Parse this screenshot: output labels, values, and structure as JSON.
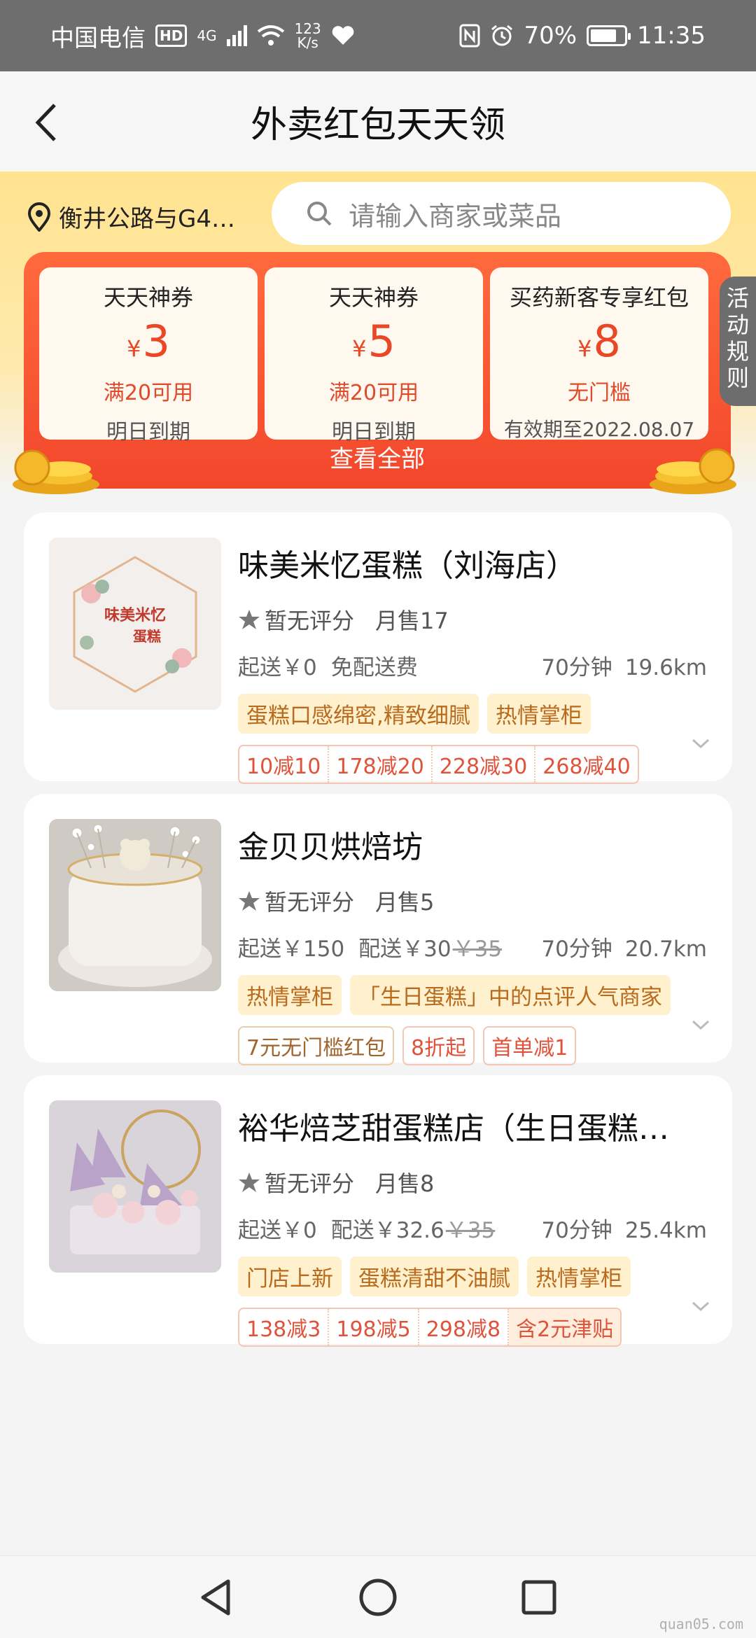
{
  "status_bar": {
    "carrier": "中国电信",
    "hd": "HD",
    "network": "4G",
    "speed_value": "123",
    "speed_unit": "K/s",
    "battery": "70%",
    "time": "11:35"
  },
  "header": {
    "title": "外卖红包天天领"
  },
  "location": {
    "text": "衡井公路与G4…"
  },
  "search": {
    "placeholder": "请输入商家或菜品"
  },
  "coupons": [
    {
      "title": "天天神券",
      "currency": "¥",
      "amount": "3",
      "condition": "满20可用",
      "expiry": "明日到期"
    },
    {
      "title": "天天神券",
      "currency": "¥",
      "amount": "5",
      "condition": "满20可用",
      "expiry": "明日到期"
    },
    {
      "title": "买药新客专享红包",
      "currency": "¥",
      "amount": "8",
      "condition": "无门槛",
      "expiry": "有效期至2022.08.07"
    }
  ],
  "view_all": "查看全部",
  "side_tab": "活动规则",
  "stores": [
    {
      "name": "味美米忆蛋糕（刘海店）",
      "rating": "暂无评分",
      "sales": "月售17",
      "min_order": "起送￥0",
      "delivery_fee": "免配送费",
      "delivery_fee_original": "",
      "time": "70分钟",
      "distance": "19.6km",
      "tags": [
        "蛋糕口感绵密,精致细腻",
        "热情掌柜"
      ],
      "promos": [
        "10减10",
        "178减20",
        "228减30",
        "268减40"
      ]
    },
    {
      "name": "金贝贝烘焙坊",
      "rating": "暂无评分",
      "sales": "月售5",
      "min_order": "起送￥150",
      "delivery_fee": "配送￥30",
      "delivery_fee_original": "￥35",
      "time": "70分钟",
      "distance": "20.7km",
      "tags": [
        "热情掌柜",
        "「生日蛋糕」中的点评人气商家"
      ],
      "promos": [
        "7元无门槛红包",
        "8折起",
        "首单减1"
      ]
    },
    {
      "name": "裕华焙芝甜蛋糕店（生日蛋糕…",
      "rating": "暂无评分",
      "sales": "月售8",
      "min_order": "起送￥0",
      "delivery_fee": "配送￥32.6",
      "delivery_fee_original": "￥35",
      "time": "70分钟",
      "distance": "25.4km",
      "tags": [
        "门店上新",
        "蛋糕清甜不油腻",
        "热情掌柜"
      ],
      "promos": [
        "138减3",
        "198减5",
        "298减8",
        "含2元津贴"
      ]
    }
  ],
  "thumb1_text": "味美米忆 蛋糕",
  "watermark": "quan05.com"
}
